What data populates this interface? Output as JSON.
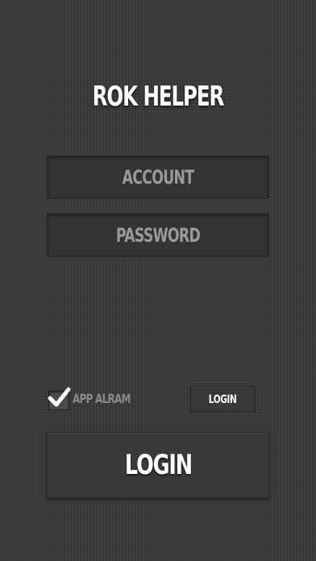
{
  "app": {
    "title": "ROK HELPER"
  },
  "form": {
    "account": {
      "value": "",
      "placeholder": "ACCOUNT"
    },
    "password": {
      "value": "",
      "placeholder": "PASSWORD"
    }
  },
  "options": {
    "alarm_label": "APP ALRAM",
    "alarm_checked": true,
    "small_login_label": "LOGIN"
  },
  "actions": {
    "login_label": "LOGIN"
  },
  "colors": {
    "background": "#3a3a3a",
    "field_background": "#333333",
    "title_text": "#ffffff",
    "placeholder_text": "#9a9a9a"
  },
  "icons": {
    "checkbox": "checkmark-icon"
  }
}
